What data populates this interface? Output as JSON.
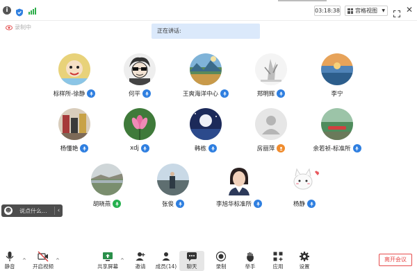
{
  "topbar": {
    "timer": "03:18:38",
    "view_mode": "宫格视图"
  },
  "recording_label": "录制中",
  "speaking_label": "正在讲话:",
  "participants": [
    {
      "name": "标样所-徐静",
      "mic": "blue"
    },
    {
      "name": "何平",
      "mic": "blue"
    },
    {
      "name": "王爽海洋中心",
      "mic": "blue"
    },
    {
      "name": "郑明辉",
      "mic": "blue"
    },
    {
      "name": "李宁",
      "mic": "none"
    },
    {
      "name": "杨懂艳",
      "mic": "blue"
    },
    {
      "name": "xdj",
      "mic": "blue"
    },
    {
      "name": "韩栋",
      "mic": "blue"
    },
    {
      "name": "房丽萍",
      "mic": "orange"
    },
    {
      "name": "余若祯-标准所",
      "mic": "blue"
    },
    {
      "name": "胡晓燕",
      "mic": "green"
    },
    {
      "name": "张俊",
      "mic": "blue"
    },
    {
      "name": "李旭华标准所",
      "mic": "blue"
    },
    {
      "name": "杨静",
      "mic": "blue"
    }
  ],
  "chat": {
    "placeholder": "说点什么..."
  },
  "toolbar": {
    "mute": "静音",
    "video": "开启视频",
    "share": "共享屏幕",
    "invite": "邀请",
    "members": "成员(14)",
    "chat": "聊天",
    "record": "录制",
    "raise_hand": "举手",
    "apps": "应用",
    "settings": "设置",
    "leave": "离开会议"
  },
  "colors": {
    "mic_blue": "#2f7fe0",
    "mic_orange": "#f08c2e",
    "mic_green": "#25b04e",
    "leave_red": "#e64a4a",
    "speaking_bg": "#dbe9fb"
  }
}
